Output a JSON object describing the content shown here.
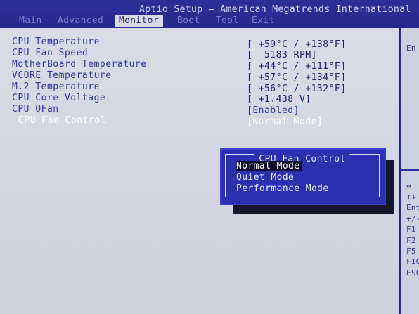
{
  "header": {
    "title": "Aptio Setup – American Megatrends International",
    "tabs": [
      {
        "label": "Main",
        "active": false
      },
      {
        "label": "Advanced",
        "active": false
      },
      {
        "label": "Monitor",
        "active": true
      },
      {
        "label": "Boot",
        "active": false
      },
      {
        "label": "Tool",
        "active": false
      },
      {
        "label": "Exit",
        "active": false
      }
    ]
  },
  "settings": [
    {
      "label": "CPU Temperature",
      "value": "[ +59°C / +138°F]"
    },
    {
      "label": "CPU Fan Speed",
      "value": "[  5183 RPM]"
    },
    {
      "label": "MotherBoard Temperature",
      "value": "[ +44°C / +111°F]"
    },
    {
      "label": "VCORE Temperature",
      "value": "[ +57°C / +134°F]"
    },
    {
      "label": "M.2 Temperature",
      "value": "[ +56°C / +132°F]"
    },
    {
      "label": "CPU Core Voltage",
      "value": "[ +1.438 V]"
    },
    {
      "label": "CPU QFan",
      "value": "[Enabled]"
    },
    {
      "label": "CPU Fan Control",
      "value": "[Normal Mode]"
    }
  ],
  "popup": {
    "title": "CPU Fan Control",
    "options": [
      "Normal Mode",
      "Quiet Mode",
      "Performance Mode"
    ],
    "selected_index": 0
  },
  "help_panel": {
    "top_text": "En",
    "keys": [
      "↔",
      "↑↓",
      "Ent",
      "+/-",
      "F1",
      "F2",
      "F5",
      "F10",
      "ESC"
    ]
  },
  "colors": {
    "title_bar": "#2b2f98",
    "panel_bg": "#d9dbe7",
    "setting_text": "#2e3a9e",
    "popup_bg": "#2a30b0",
    "highlight_bg": "#0c0e30"
  }
}
